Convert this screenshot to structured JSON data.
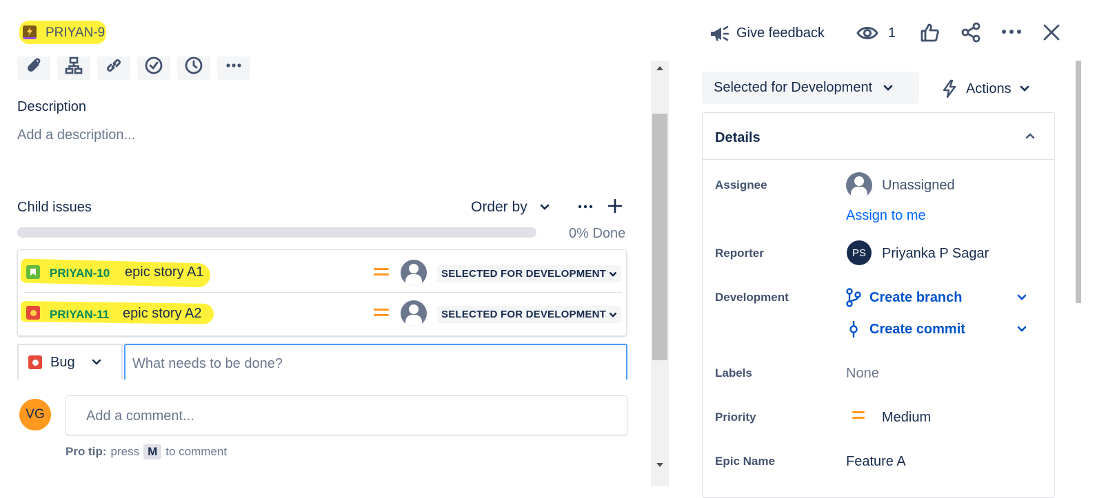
{
  "header": {
    "issue_key": "PRIYAN-9",
    "give_feedback": "Give feedback",
    "watch_count": "1"
  },
  "description": {
    "heading": "Description",
    "placeholder": "Add a description..."
  },
  "child_issues": {
    "heading": "Child issues",
    "order_by": "Order by",
    "progress_percent": 0,
    "progress_label": "0% Done",
    "items": [
      {
        "key": "PRIYAN-10",
        "summary": "epic story A1",
        "type": "story",
        "status": "SELECTED FOR DEVELOPMENT"
      },
      {
        "key": "PRIYAN-11",
        "summary": "epic story A2",
        "type": "bug",
        "status": "SELECTED FOR DEVELOPMENT"
      }
    ],
    "create": {
      "type_label": "Bug",
      "placeholder": "What needs to be done?"
    }
  },
  "comment": {
    "avatar_initials": "VG",
    "placeholder": "Add a comment...",
    "tip_bold": "Pro tip:",
    "tip_press": "press",
    "tip_key": "M",
    "tip_rest": "to comment"
  },
  "sidebar": {
    "status_button": "Selected for Development",
    "actions_button": "Actions",
    "details_heading": "Details",
    "assignee_label": "Assignee",
    "assignee_value": "Unassigned",
    "assign_to_me": "Assign to me",
    "reporter_label": "Reporter",
    "reporter_initials": "PS",
    "reporter_value": "Priyanka P Sagar",
    "development_label": "Development",
    "create_branch": "Create branch",
    "create_commit": "Create commit",
    "labels_label": "Labels",
    "labels_value": "None",
    "priority_label": "Priority",
    "priority_value": "Medium",
    "epic_name_label": "Epic Name",
    "epic_name_value": "Feature A"
  },
  "colors": {
    "highlight": "#fff13a",
    "link_blue": "#0052cc",
    "story_green": "#63ba3c",
    "bug_red": "#e5493a",
    "epic_purple": "#904ee2",
    "priority_orange": "#ff991f",
    "focus_blue": "#4c9aff"
  }
}
